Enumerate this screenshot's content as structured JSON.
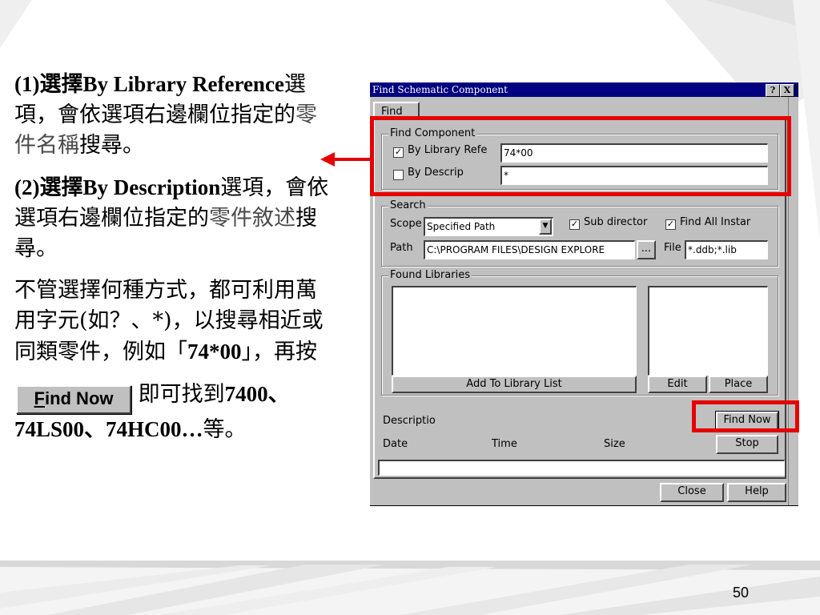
{
  "slide": {
    "para1": [
      "(1)選擇",
      "By Library Reference",
      "選項，會依選項右邊欄位指定的",
      "零件名稱",
      "搜尋。"
    ],
    "para2": [
      "(2)選擇",
      "By Description",
      "選項，會依選項右邊欄位指定的",
      "零件敘述",
      "搜尋。"
    ],
    "para3": [
      "不管選擇何種方式，都可利用萬用字元(",
      "如？、*",
      ")，以搜尋相近或同類零件，例如「",
      "74*00",
      "」，再按"
    ],
    "para4": [
      "即可找到",
      "7400、74LS00、74HC00…",
      "等。"
    ],
    "inline_button": {
      "accel": "F",
      "rest": "ind Now"
    },
    "page_number": "50"
  },
  "dialog": {
    "title": "Find Schematic Component",
    "help_btn": "?",
    "close_btn": "X",
    "tab": "Find",
    "find_component": {
      "legend": "Find Component",
      "by_library_label": "By Library Refe",
      "by_library_checked": true,
      "by_library_value": "74*00",
      "by_descrip_label": "By Descrip",
      "by_descrip_checked": false,
      "by_descrip_value": "*"
    },
    "search": {
      "legend": "Search",
      "scope_label": "Scope",
      "scope_value": "Specified Path",
      "sub_directories_label": "Sub director",
      "sub_directories_checked": true,
      "find_all_label": "Find All Instar",
      "find_all_checked": true,
      "path_label": "Path",
      "path_value": "C:\\PROGRAM FILES\\DESIGN EXPLORE",
      "browse_btn": "...",
      "file_label": "File",
      "file_value": "*.ddb;*.lib"
    },
    "found_libraries": {
      "legend": "Found Libraries",
      "add_btn": "Add To Library List",
      "edit_btn": "Edit",
      "place_btn": "Place"
    },
    "description_label": "Descriptio",
    "date_label": "Date",
    "time_label": "Time",
    "size_label": "Size",
    "find_now_btn": "Find Now",
    "stop_btn": "Stop",
    "close_btn_bottom": "Close",
    "help_btn_bottom": "Help"
  },
  "colors": {
    "highlight": "#e60000",
    "titlebar": "#000080",
    "face": "#c0c0c0"
  }
}
